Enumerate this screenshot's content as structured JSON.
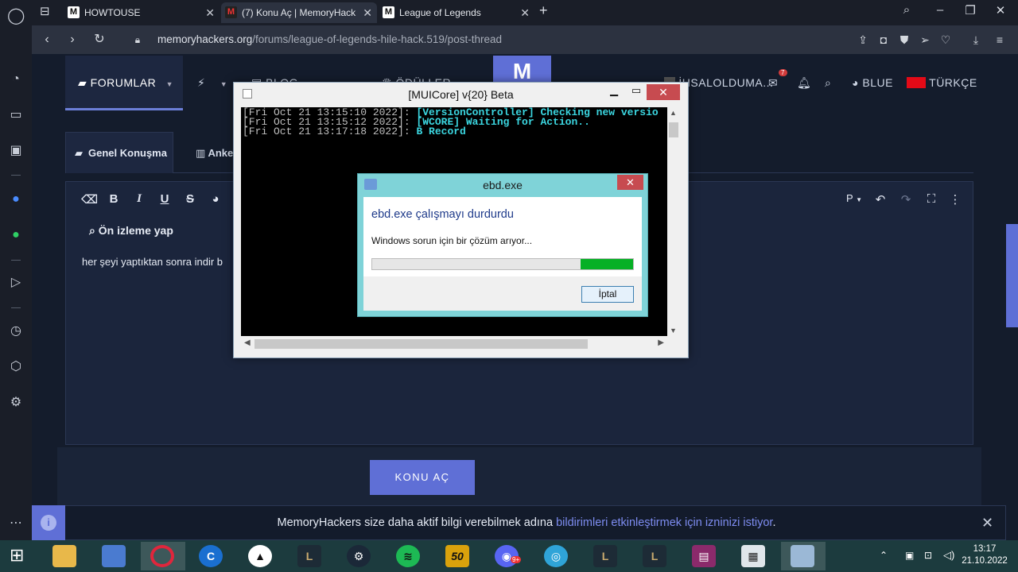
{
  "browser": {
    "tabs": [
      {
        "label": "HOWTOUSE",
        "favicon": "M"
      },
      {
        "label": "(7) Konu Aç | MemoryHack",
        "favicon": "M"
      },
      {
        "label": "League of Legends",
        "favicon": "M"
      }
    ],
    "url_host": "memoryhackers.org",
    "url_path": "/forums/league-of-legends-hile-hack.519/post-thread"
  },
  "site": {
    "nav_forums": "FORUMLAR",
    "nav_blog": "BLOG",
    "nav_rewards": "ÖDÜLLER",
    "user_name": "İHSALOLDUMA...",
    "mail_badge": "7",
    "theme": "BLUE",
    "language": "TÜRKÇE",
    "logo_letter": "M",
    "accent": "#5f6fd6"
  },
  "editor": {
    "tab_general": "Genel Konuşma",
    "tab_poll": "Anke",
    "toolbar_bold": "B",
    "toolbar_italic": "I",
    "toolbar_underline": "U",
    "toolbar_strike": "S",
    "toolbar_paragraph": "P",
    "preview_label": "Ön izleme yap",
    "body_text": "her şeyi yaptıktan sonra indir b"
  },
  "submit_label": "KONU AÇ",
  "notice": {
    "text_before": "MemoryHackers size daha aktif bilgi verebilmek adına ",
    "link_text": "bildirimleri etkinleştirmek için izninizi istiyor",
    "text_after": "."
  },
  "console": {
    "title": "[MUICore] v{20} Beta",
    "lines": [
      {
        "ts": "[Fri Oct 21 13:15:10 2022]: ",
        "msg": "[VersionController] Checking new versio"
      },
      {
        "ts": "[Fri Oct 21 13:15:12 2022]: ",
        "msg": "[WCORE] Waiting for Action.."
      },
      {
        "ts": "[Fri Oct 21 13:17:18 2022]: ",
        "msg": "B Record"
      }
    ]
  },
  "dialog": {
    "title": "ebd.exe",
    "heading": "ebd.exe çalışmayı durdurdu",
    "message": "Windows sorun için bir çözüm arıyor...",
    "cancel_label": "İptal",
    "progress": 0.2
  },
  "taskbar": {
    "time": "13:17",
    "date": "21.10.2022",
    "discord_badge": "9+",
    "app_50_label": "50"
  }
}
